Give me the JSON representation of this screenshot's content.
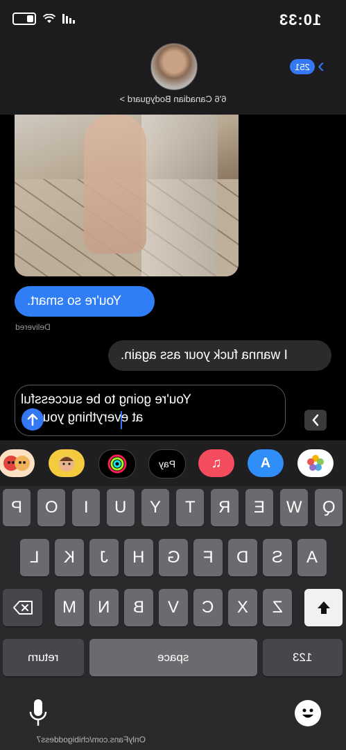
{
  "status_bar": {
    "time": "10:33"
  },
  "header": {
    "unread_count": "251",
    "contact_name": "6'6 Canadian Bodyguard >"
  },
  "messages": [
    {
      "type": "image",
      "direction": "incoming"
    },
    {
      "type": "text",
      "direction": "outgoing",
      "text": "You're so smart.",
      "status": "Delivered"
    },
    {
      "type": "text",
      "direction": "incoming",
      "text": "I wanna fuck your ass again."
    }
  ],
  "compose": {
    "line1": "You're going to be successful",
    "line2": "at everything you do."
  },
  "app_strip": [
    {
      "name": "photos-icon",
      "label": ""
    },
    {
      "name": "app-store-icon",
      "label": "A"
    },
    {
      "name": "music-icon",
      "label": "♫"
    },
    {
      "name": "apple-pay-icon",
      "label": "Pay"
    },
    {
      "name": "activity-icon",
      "label": ""
    },
    {
      "name": "memoji-icon",
      "label": ""
    },
    {
      "name": "stickers-icon",
      "label": ""
    }
  ],
  "keyboard": {
    "row1": [
      "Q",
      "W",
      "E",
      "R",
      "T",
      "Y",
      "U",
      "I",
      "O",
      "P"
    ],
    "row2": [
      "A",
      "S",
      "D",
      "F",
      "G",
      "H",
      "J",
      "K",
      "L"
    ],
    "row3": [
      "Z",
      "X",
      "C",
      "V",
      "B",
      "N",
      "M"
    ],
    "numbers": "123",
    "space": "space",
    "return": "return"
  },
  "watermark": "OnlyFans.com/chibigoddess7",
  "colors": {
    "accent": "#3478f6",
    "outgoing_bubble": "#2f7ef6",
    "incoming_bubble": "#2b2b2d"
  }
}
